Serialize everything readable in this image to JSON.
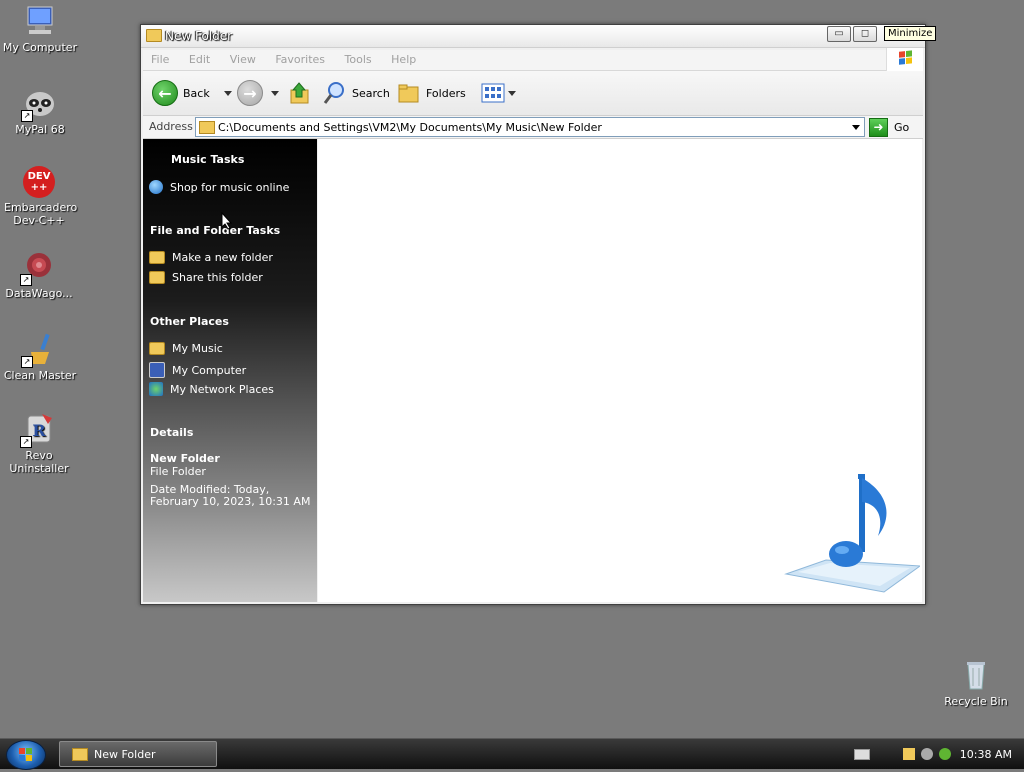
{
  "desktop": {
    "icons": [
      {
        "label": "My Computer",
        "icon": "monitor-icon"
      },
      {
        "label": "MyPal 68",
        "icon": "raccoon-icon"
      },
      {
        "label": "Embarcadero Dev-C++",
        "icon": "devcpp-icon",
        "badge": "DEV",
        "badge2": "++"
      },
      {
        "label": "DataWago...",
        "icon": "datawagon-icon"
      },
      {
        "label": "Clean Master",
        "icon": "broom-icon"
      },
      {
        "label": "Revo Uninstaller",
        "icon": "revo-icon"
      }
    ],
    "recycle_bin": "Recycle Bin"
  },
  "window": {
    "title": "New Folder",
    "tooltip": "Minimize",
    "menu": [
      "File",
      "Edit",
      "View",
      "Favorites",
      "Tools",
      "Help"
    ],
    "toolbar": {
      "back": "Back",
      "search": "Search",
      "folders": "Folders"
    },
    "address": {
      "label": "Address",
      "path": "C:\\Documents and Settings\\VM2\\My Documents\\My Music\\New Folder",
      "go": "Go"
    },
    "taskpane": {
      "music_tasks": {
        "title": "Music Tasks",
        "items": [
          "Shop for music online"
        ]
      },
      "file_tasks": {
        "title": "File and Folder Tasks",
        "items": [
          "Make a new folder",
          "Share this folder"
        ]
      },
      "other_places": {
        "title": "Other Places",
        "items": [
          "My Music",
          "My Computer",
          "My Network Places"
        ]
      },
      "details": {
        "title": "Details",
        "name": "New Folder",
        "type": "File Folder",
        "modified_1": "Date Modified: Today,",
        "modified_2": "February 10, 2023, 10:31 AM"
      }
    }
  },
  "taskbar": {
    "task": "New Folder",
    "clock": "10:38 AM"
  },
  "colors": {
    "desktop": "#7b7b7b",
    "accent": "#2a6fc8"
  }
}
